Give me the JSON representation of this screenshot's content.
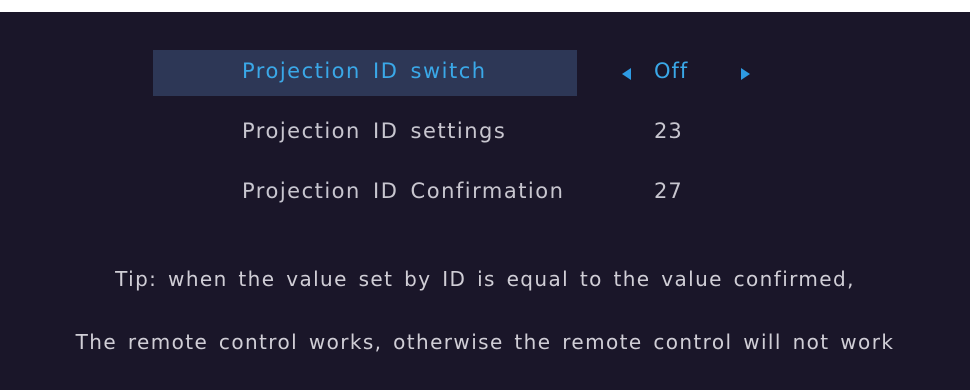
{
  "menu": {
    "items": [
      {
        "label": "Projection ID switch",
        "value": "Off"
      },
      {
        "label": "Projection ID settings",
        "value": "23"
      },
      {
        "label": "Projection ID Confirmation",
        "value": "27"
      }
    ]
  },
  "tip": {
    "line1": "Tip: when the value set by ID is equal to the value confirmed,",
    "line2": "The remote control works, otherwise the remote control will not work"
  },
  "colors": {
    "background": "#1a1629",
    "selection": "#2d3756",
    "active_text": "#3aa8e8",
    "text": "#c8c6cf"
  },
  "icons": {
    "decrease": "triangle-left-icon",
    "increase": "triangle-right-icon"
  }
}
